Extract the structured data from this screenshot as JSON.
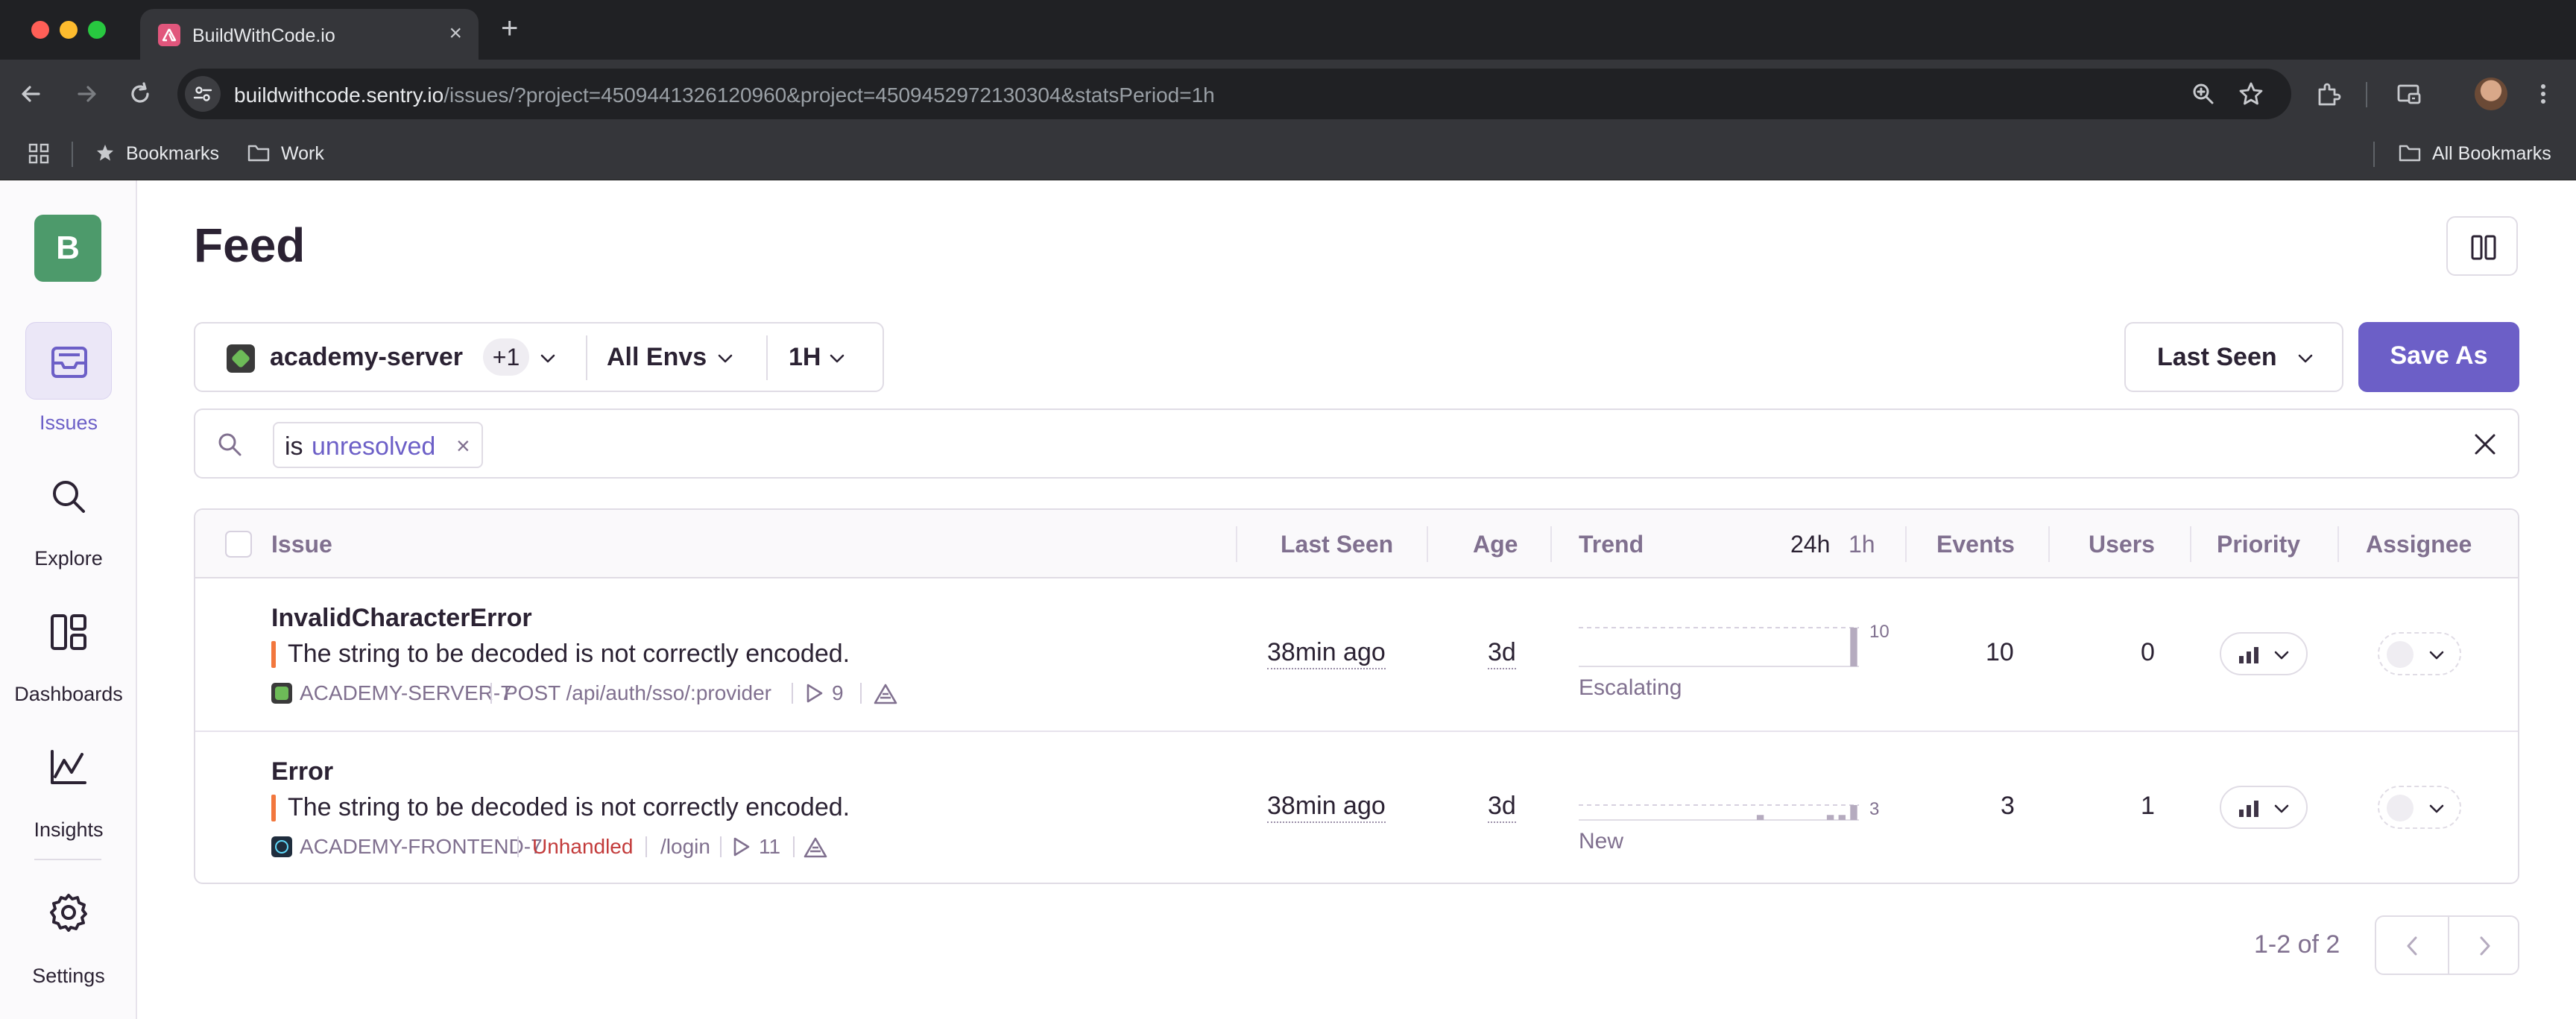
{
  "browser": {
    "tab_title": "BuildWithCode.io",
    "url_host": "buildwithcode.sentry.io",
    "url_path": "/issues/?project=4509441326120960&project=4509452972130304&statsPeriod=1h",
    "bookmarks": [
      {
        "label": "Bookmarks",
        "icon": "star-icon"
      },
      {
        "label": "Work",
        "icon": "folder-icon"
      }
    ],
    "all_bookmarks": "All Bookmarks"
  },
  "sidebar": {
    "org_initial": "B",
    "items": [
      {
        "label": "Issues",
        "icon": "issues-inbox-icon",
        "active": true
      },
      {
        "label": "Explore",
        "icon": "search-icon"
      },
      {
        "label": "Dashboards",
        "icon": "dashboards-icon"
      },
      {
        "label": "Insights",
        "icon": "insights-graph-icon"
      },
      {
        "label": "Settings",
        "icon": "gear-icon"
      }
    ]
  },
  "page": {
    "title": "Feed"
  },
  "filters": {
    "project": "academy-server",
    "project_extra": "+1",
    "environment": "All Envs",
    "period": "1H",
    "sort": "Last Seen",
    "save_as": "Save As"
  },
  "search": {
    "token_key": "is",
    "token_value": "unresolved"
  },
  "table": {
    "headers": {
      "issue": "Issue",
      "last_seen": "Last Seen",
      "age": "Age",
      "trend": "Trend",
      "trend_24h": "24h",
      "trend_1h": "1h",
      "events": "Events",
      "users": "Users",
      "priority": "Priority",
      "assignee": "Assignee"
    },
    "rows": [
      {
        "title": "InvalidCharacterError",
        "message": "The string to be decoded is not correctly encoded.",
        "short_id": "ACADEMY-SERVER-7",
        "project_icon": "node-project-icon",
        "culprit": "POST /api/auth/sso/:provider",
        "replays": "9",
        "last_seen": "38min ago",
        "age": "3d",
        "trend_max": "10",
        "trend_values": [
          0,
          0,
          0,
          0,
          0,
          0,
          0,
          0,
          0,
          0,
          0,
          0,
          0,
          0,
          0,
          0,
          0,
          0,
          0,
          0,
          0,
          0,
          0,
          10
        ],
        "trend_status": "Escalating",
        "events": "10",
        "users": "0"
      },
      {
        "title": "Error",
        "message": "The string to be decoded is not correctly encoded.",
        "short_id": "ACADEMY-FRONTEND-7",
        "project_icon": "react-project-icon",
        "unhandled": "Unhandled",
        "culprit": "/login",
        "replays": "11",
        "last_seen": "38min ago",
        "age": "3d",
        "trend_max": "3",
        "trend_values": [
          0,
          0,
          0,
          0,
          0,
          0,
          0,
          0,
          0,
          0,
          0,
          0,
          0,
          0,
          0,
          1,
          0,
          0,
          0,
          0,
          0,
          1,
          1,
          3
        ],
        "trend_status": "New",
        "events": "3",
        "users": "1"
      }
    ]
  },
  "pagination": {
    "caption": "1-2 of 2"
  },
  "colors": {
    "accent": "#6c5fc7",
    "issue_level_bar": "#f2773d",
    "unhandled": "#c33b3b"
  }
}
